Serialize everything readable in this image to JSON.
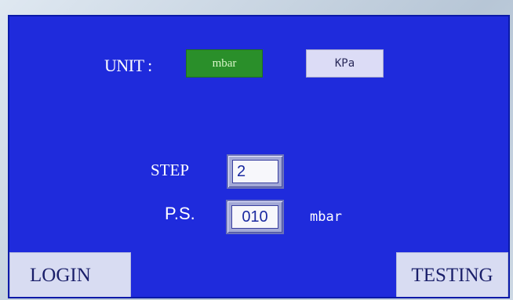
{
  "unit": {
    "label": "UNIT :",
    "options": [
      "mbar",
      "KPa"
    ],
    "selected": "mbar",
    "selected_color": "#2a8f2a"
  },
  "step": {
    "label": "STEP",
    "value": "2"
  },
  "pressure": {
    "label": "P.S.",
    "value": "010",
    "unit": "mbar"
  },
  "buttons": {
    "login": "LOGIN",
    "testing": "TESTING"
  },
  "colors": {
    "screen_background": "#1f2bdc",
    "button_background": "#d8dcf2"
  }
}
